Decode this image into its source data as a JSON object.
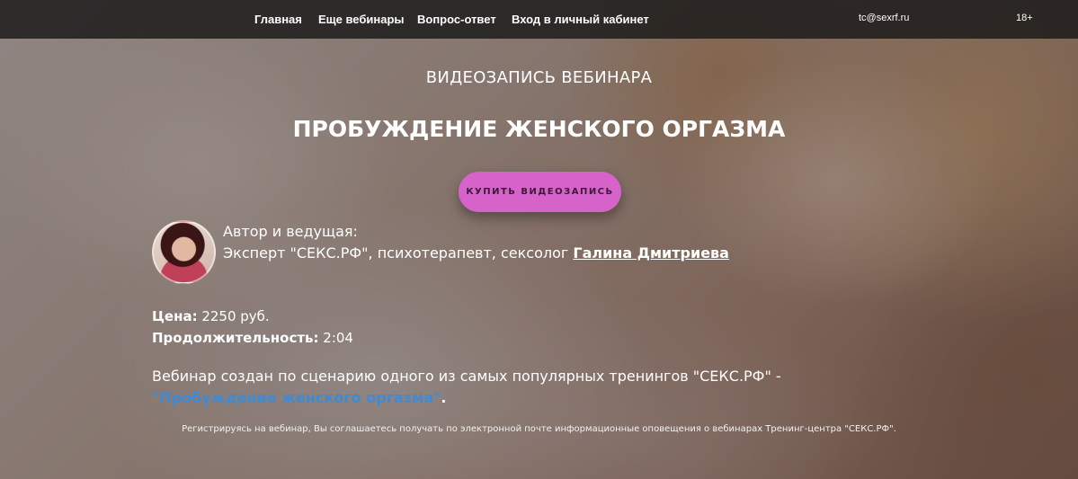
{
  "nav": {
    "items": [
      {
        "label": "Главная"
      },
      {
        "label": "Еще вебинары"
      },
      {
        "label": "Вопрос-ответ"
      },
      {
        "label": "Вход в личный кабинет"
      }
    ],
    "email": "tc@sexrf.ru",
    "age_badge": "18+"
  },
  "hero": {
    "kicker": "ВИДЕОЗАПИСЬ ВЕБИНАРА",
    "title": "ПРОБУЖДЕНИЕ ЖЕНСКОГО ОРГАЗМА",
    "buy_button": "КУПИТЬ ВИДЕОЗАПИСЬ"
  },
  "author": {
    "heading": "Автор и ведущая:",
    "description": "Эксперт \"СЕКС.РФ\", психотерапевт, сексолог ",
    "name": "Галина Дмитриева"
  },
  "details": {
    "price_label": "Цена:",
    "price_value": " 2250 руб.",
    "duration_label": "Продолжительность:",
    "duration_value": " 2:04"
  },
  "description": {
    "text": "Вебинар создан по сценарию одного из самых популярных тренингов \"СЕКС.РФ\" - ",
    "link": "\"Пробуждение женского оргазма\"",
    "suffix": "."
  },
  "consent": "Регистрируясь на вебинар, Вы соглашаетесь получать по электронной почте информационные оповещения о вебинарах Тренинг-центра \"СЕКС.РФ\".",
  "colors": {
    "buy_button": "#d563c9",
    "link": "#3d8bd6",
    "navbar": "#191919"
  }
}
